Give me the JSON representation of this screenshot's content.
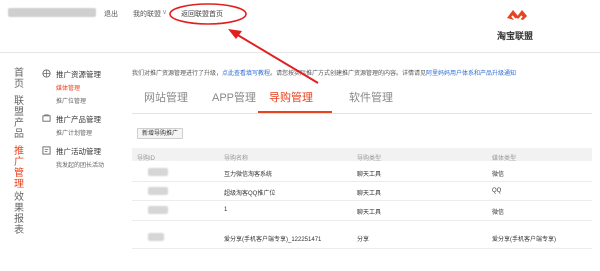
{
  "header": {
    "logout": "退出",
    "my_union": "我的联盟",
    "back_home": "返回联盟首页",
    "logo_text": "淘宝联盟"
  },
  "left_nav": {
    "home": "首页",
    "products": "联盟产品",
    "promo": "推广管理",
    "reports": "效果报表"
  },
  "sub_nav": {
    "groups": [
      {
        "title": "推广资源管理",
        "items": [
          "媒体管理",
          "推广位管理"
        ]
      },
      {
        "title": "推广产品管理",
        "items": [
          "推广计划管理"
        ]
      },
      {
        "title": "推广活动管理",
        "items": [
          "我发起的团长活动"
        ]
      }
    ]
  },
  "notice": {
    "text": "我们对推广资源管理进行了升级，",
    "link1": "点此查看填写教程",
    "mid": "。请您按实际推广方式创建推广资源管理的内容。详情请见",
    "link2": "阿里妈妈用户体系和产品升级通知"
  },
  "tabs": [
    "网站管理",
    "APP管理",
    "导购管理",
    "软件管理"
  ],
  "add_button": "新增导购推广",
  "table": {
    "headers": [
      "导购ID",
      "导购名称",
      "导购类型",
      "媒体类型"
    ],
    "rows": [
      {
        "name": "互力微信淘客系统",
        "type": "聊天工具",
        "media": "微信"
      },
      {
        "name": "超级淘客QQ推广位",
        "type": "聊天工具",
        "media": "QQ"
      },
      {
        "name": "1",
        "type": "聊天工具",
        "media": "微信"
      },
      {
        "name": "爱分享(手机客户端专享)_122251471",
        "type": "分享",
        "media": "爱分享(手机客户端专享)"
      }
    ]
  },
  "colors": {
    "accent": "#e8431f",
    "link": "#2b6bd6",
    "arrow": "#e02020"
  }
}
